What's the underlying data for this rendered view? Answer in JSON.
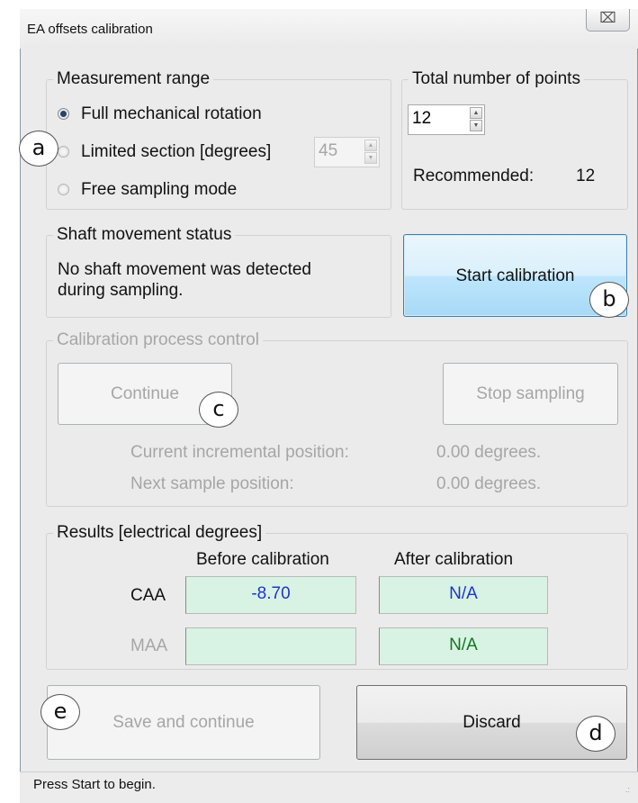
{
  "window": {
    "title": "EA offsets calibration",
    "close_glyph": "⌧"
  },
  "measurement_range": {
    "label": "Measurement range",
    "selected": "Full mechanical rotation",
    "options": [
      "Full mechanical rotation",
      "Limited section [degrees]",
      "Free sampling mode"
    ],
    "limited_value": "45"
  },
  "points": {
    "label": "Total number of points",
    "value": "12",
    "recommended_label": "Recommended:",
    "recommended_value": "12"
  },
  "shaft": {
    "label": "Shaft movement status",
    "text_line1": "No shaft movement was detected",
    "text_line2": "during sampling."
  },
  "start_button": "Start calibration",
  "process": {
    "label": "Calibration process control",
    "continue": "Continue",
    "stop": "Stop sampling",
    "current_label": "Current incremental position:",
    "current_value": "0.00 degrees.",
    "next_label": "Next sample position:",
    "next_value": "0.00 degrees."
  },
  "results": {
    "label": "Results [electrical degrees]",
    "col_before": "Before calibration",
    "col_after": "After calibration",
    "rows": [
      {
        "name": "CAA",
        "before": "-8.70",
        "after": "N/A"
      },
      {
        "name": "MAA",
        "before": "",
        "after": "N/A"
      }
    ]
  },
  "bottom": {
    "save": "Save and continue",
    "discard": "Discard"
  },
  "status_text": "Press Start to begin.",
  "callouts": {
    "a": "a",
    "b": "b",
    "c": "c",
    "d": "d",
    "e": "e"
  },
  "colors": {
    "field_bg": "#d8f3e3",
    "value_blue": "#2233cc",
    "value_green": "#117722",
    "focus_border": "#3c7fb1"
  }
}
